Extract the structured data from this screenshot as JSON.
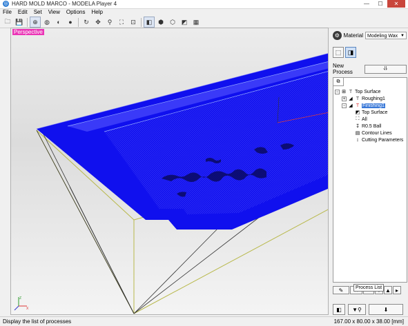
{
  "window": {
    "title": "HARD MOLD MARCO - MODELA Player 4",
    "minimize": "—",
    "maximize": "☐",
    "close": "✕"
  },
  "menu": [
    "File",
    "Edit",
    "Set",
    "View",
    "Options",
    "Help"
  ],
  "toolbar": [
    {
      "name": "open-icon",
      "glyph": "🗀"
    },
    {
      "name": "save-icon",
      "glyph": "💾"
    },
    {
      "name": "sep"
    },
    {
      "name": "view-globe-icon",
      "glyph": "⊕",
      "active": true
    },
    {
      "name": "view-sphere-icon",
      "glyph": "◍"
    },
    {
      "name": "view-shade-icon",
      "glyph": "◐"
    },
    {
      "name": "view-dark-icon",
      "glyph": "●"
    },
    {
      "name": "sep"
    },
    {
      "name": "rotate-icon",
      "glyph": "↻"
    },
    {
      "name": "pan-icon",
      "glyph": "✥"
    },
    {
      "name": "zoom-icon",
      "glyph": "⚲"
    },
    {
      "name": "fit-icon",
      "glyph": "⛶"
    },
    {
      "name": "zoom-window-icon",
      "glyph": "⊡"
    },
    {
      "name": "sep"
    },
    {
      "name": "view-front-icon",
      "glyph": "◧",
      "active": true
    },
    {
      "name": "view-iso-icon",
      "glyph": "⬢"
    },
    {
      "name": "view-cube-icon",
      "glyph": "⬡"
    },
    {
      "name": "view-box-icon",
      "glyph": "◩"
    },
    {
      "name": "view-grid-icon",
      "glyph": "▦"
    }
  ],
  "viewport": {
    "label": "Perspective"
  },
  "panel": {
    "material_label": "Material",
    "material_value": "Modeling Wax",
    "new_process_label": "New Process",
    "tree": [
      {
        "indent": 0,
        "pm": "⊟",
        "icon": "⊞",
        "icon2": "T",
        "label": "Top Surface"
      },
      {
        "indent": 1,
        "pm": "⊞",
        "icon": "◢",
        "icon2": "T",
        "label": "Roughing1"
      },
      {
        "indent": 1,
        "pm": "⊟",
        "icon": "◢",
        "icon2": "T",
        "label": "Finishing1",
        "selected": true
      },
      {
        "indent": 2,
        "pm": "",
        "icon": "◩",
        "icon2": "",
        "label": "Top Surface"
      },
      {
        "indent": 2,
        "pm": "",
        "icon": "⛶",
        "icon2": "",
        "label": "All"
      },
      {
        "indent": 2,
        "pm": "",
        "icon": "↧",
        "icon2": "",
        "label": "R0.5 Ball"
      },
      {
        "indent": 2,
        "pm": "",
        "icon": "▤",
        "icon2": "",
        "label": "Contour Lines"
      },
      {
        "indent": 2,
        "pm": "",
        "icon": "↕",
        "icon2": "",
        "label": "Cutting Parameters"
      }
    ],
    "tooltip": "Process List"
  },
  "status": {
    "left": "Display the list of processes",
    "right": "167.00 x 80.00 x 38.00 [mm]"
  },
  "colors": {
    "mesh": "#1010ee",
    "perspective_badge": "#ea35b6"
  }
}
